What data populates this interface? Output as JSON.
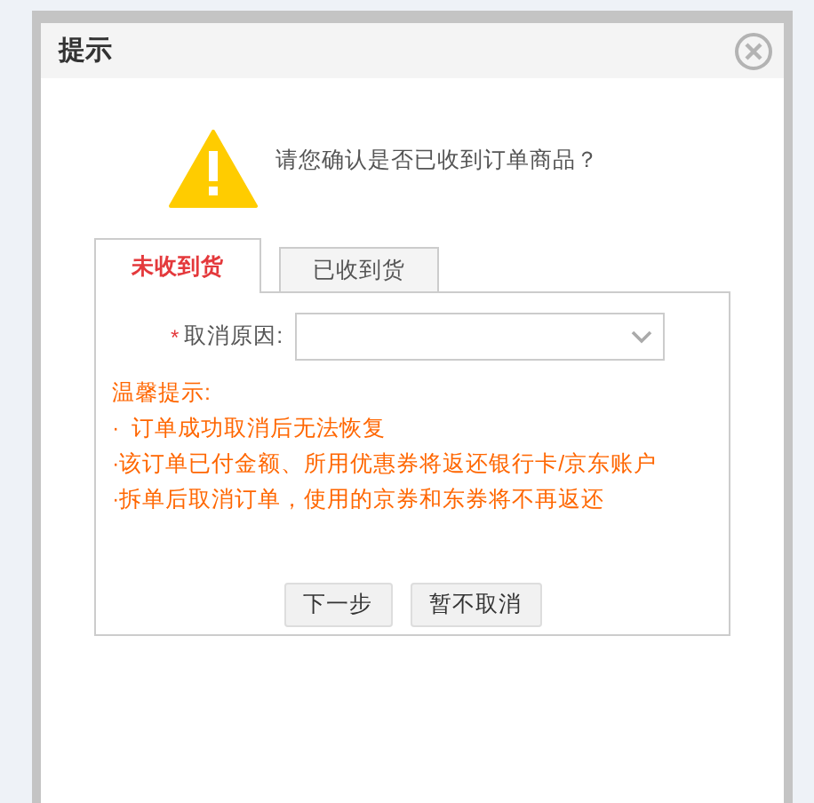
{
  "dialog": {
    "title": "提示",
    "message": "请您确认是否已收到订单商品？"
  },
  "tabs": [
    {
      "label": "未收到货",
      "selected": true
    },
    {
      "label": "已收到货",
      "selected": false
    }
  ],
  "reason": {
    "required_mark": "*",
    "label": "取消原因:"
  },
  "tips": {
    "heading": "温馨提示:",
    "items": [
      "·  订单成功取消后无法恢复",
      "·该订单已付金额、所用优惠券将返还银行卡/京东账户",
      "·拆单后取消订单，使用的京券和东券将不再返还"
    ]
  },
  "buttons": [
    "下一步",
    "暂不取消"
  ]
}
